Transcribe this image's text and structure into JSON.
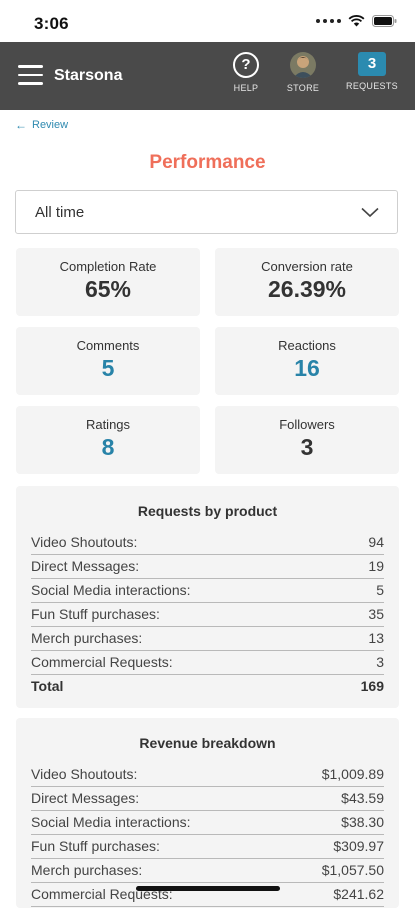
{
  "status_bar": {
    "time": "3:06"
  },
  "header": {
    "app_name": "Starsona",
    "nav": [
      {
        "label": "HELP",
        "icon": "help-circle-icon"
      },
      {
        "label": "STORE",
        "icon": "avatar-icon"
      },
      {
        "label": "REQUESTS",
        "badge": "3"
      }
    ]
  },
  "back_link": {
    "label": "Review"
  },
  "page": {
    "title": "Performance"
  },
  "range_select": {
    "value": "All time"
  },
  "stats": [
    {
      "label": "Completion Rate",
      "value": "65%"
    },
    {
      "label": "Conversion rate",
      "value": "26.39%"
    },
    {
      "label": "Comments",
      "value": "5"
    },
    {
      "label": "Reactions",
      "value": "16"
    },
    {
      "label": "Ratings",
      "value": "8"
    },
    {
      "label": "Followers",
      "value": "3"
    }
  ],
  "requests_by_product": {
    "title": "Requests by product",
    "rows": [
      {
        "label": "Video Shoutouts:",
        "value": "94"
      },
      {
        "label": "Direct Messages:",
        "value": "19"
      },
      {
        "label": "Social Media interactions:",
        "value": "5"
      },
      {
        "label": "Fun Stuff purchases:",
        "value": "35"
      },
      {
        "label": "Merch purchases:",
        "value": "13"
      },
      {
        "label": "Commercial Requests:",
        "value": "3"
      }
    ],
    "total_label": "Total",
    "total_value": "169"
  },
  "revenue_breakdown": {
    "title": "Revenue breakdown",
    "rows": [
      {
        "label": "Video Shoutouts:",
        "value": "$1,009.89"
      },
      {
        "label": "Direct Messages:",
        "value": "$43.59"
      },
      {
        "label": "Social Media interactions:",
        "value": "$38.30"
      },
      {
        "label": "Fun Stuff purchases:",
        "value": "$309.97"
      },
      {
        "label": "Merch purchases:",
        "value": "$1,057.50"
      },
      {
        "label": "Commercial Requests:",
        "value": "$241.62"
      }
    ]
  },
  "colors": {
    "header_bg": "#4a4a4a",
    "accent_title": "#ef6f5a",
    "accent_number": "#2883a8",
    "badge_bg": "#2b8bb0",
    "card_bg": "#f4f4f4"
  }
}
